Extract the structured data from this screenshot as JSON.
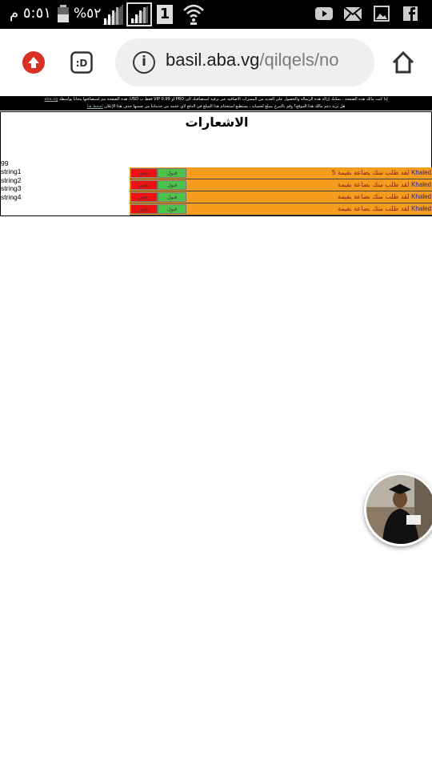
{
  "status_bar": {
    "time": "٥:٥١ م",
    "battery": "%٥٢",
    "sim_number": "1"
  },
  "browser": {
    "url_host": "basil.aba.vg",
    "url_path": "/qilqels/no"
  },
  "banner": {
    "line1": "إذا كنت مالك هذه الصفحة ، يمكنك إزالة هذه الرسالة والحصول على العديد من المميزات الاضافية عبر ترقية استضافتك الى PRO او VIP 0.99 فقط ب USD. هذه الصفحة يتم استضافتها مجانا بواسطة",
    "line1_link": "aba.vg",
    "line2": "هل تريد دعم مالك هذا الموقع؟ وقم بالتبرع بمبلغ لحسابه ، يستطيع استخدام هذا المبلغ في الدفع لاي خدمة من خدماتنا من ضمنها حذف هذا الإعلان",
    "line2_link": "اضغط هنا"
  },
  "page": {
    "title": "الاشعارات",
    "side_lines": [
      "99",
      "string1",
      "string2",
      "string3",
      "string4"
    ]
  },
  "notifications": [
    {
      "user": "Khaled",
      "message": "لقد طلب منك بضاعة بقيمة 5",
      "accept": "قبول",
      "reject": "رفض"
    },
    {
      "user": "Khaled",
      "message": "لقد طلب منك بضاعة بقيمة",
      "accept": "قبول",
      "reject": "رفض"
    },
    {
      "user": "Khaled",
      "message": "لقد طلب منك بضاعة بقيمة",
      "accept": "قبول",
      "reject": "رفض"
    },
    {
      "user": "Khaled",
      "message": "لقد طلب منك بضاعة بقيمة",
      "accept": "قبول",
      "reject": "رفض"
    }
  ],
  "colors": {
    "row_bg": "#f39c1e",
    "accept_bg": "#4cc24c",
    "reject_bg": "#ee1111"
  },
  "icons": [
    "battery-icon",
    "signal-icon",
    "signal-sim-icon",
    "wifi-icon",
    "youtube-icon",
    "gmail-icon",
    "gallery-icon",
    "facebook-icon",
    "upload-icon",
    "emoji-tab-icon",
    "info-icon",
    "home-icon"
  ]
}
